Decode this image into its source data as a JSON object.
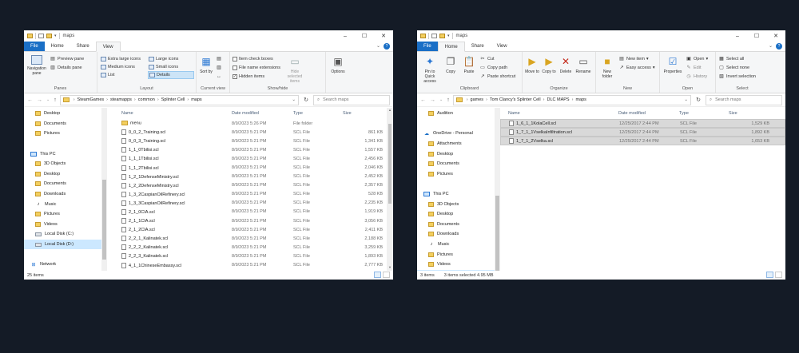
{
  "left": {
    "title": "maps",
    "tabs": [
      "File",
      "Home",
      "Share",
      "View"
    ],
    "ribbon": {
      "panes": {
        "name": "Panes",
        "navigation_pane": "Navigation pane",
        "preview_pane": "Preview pane",
        "details_pane": "Details pane"
      },
      "layout": {
        "name": "Layout",
        "items": [
          "Extra large icons",
          "Large icons",
          "Medium icons",
          "Small icons",
          "List",
          "Details"
        ]
      },
      "current_view": {
        "name": "Current view",
        "sort_by": "Sort by"
      },
      "show_hide": {
        "name": "Show/hide",
        "item_check_boxes": "Item check boxes",
        "file_name_extensions": "File name extensions",
        "hidden_items": "Hidden items",
        "hide_selected": "Hide selected items"
      },
      "options": "Options"
    },
    "path": [
      "SteamGames",
      "steamapps",
      "common",
      "Splinter Cell",
      "maps"
    ],
    "search_placeholder": "Search maps",
    "nav": [
      {
        "label": "Desktop",
        "icon": "folder-icon"
      },
      {
        "label": "Documents",
        "icon": "folder-icon"
      },
      {
        "label": "Pictures",
        "icon": "folder-icon"
      },
      {
        "label": "",
        "icon": ""
      },
      {
        "label": "This PC",
        "icon": "pc-icon"
      },
      {
        "label": "3D Objects",
        "icon": "folder-icon"
      },
      {
        "label": "Desktop",
        "icon": "folder-icon"
      },
      {
        "label": "Documents",
        "icon": "folder-icon"
      },
      {
        "label": "Downloads",
        "icon": "folder-icon"
      },
      {
        "label": "Music",
        "icon": "music-icon"
      },
      {
        "label": "Pictures",
        "icon": "folder-icon"
      },
      {
        "label": "Videos",
        "icon": "folder-icon"
      },
      {
        "label": "Local Disk (C:)",
        "icon": "drive-icon"
      },
      {
        "label": "Local Disk (D:)",
        "icon": "drive-icon"
      },
      {
        "label": "",
        "icon": ""
      },
      {
        "label": "Network",
        "icon": "network-icon"
      }
    ],
    "columns": [
      "Name",
      "Date modified",
      "Type",
      "Size"
    ],
    "files": [
      {
        "name": "menu",
        "date": "8/9/2023 5:26 PM",
        "type": "File folder",
        "size": "",
        "folder": true
      },
      {
        "name": "0_0_2_Training.scl",
        "date": "8/9/2023 5:21 PM",
        "type": "SCL File",
        "size": "861 KB"
      },
      {
        "name": "0_0_3_Training.scl",
        "date": "8/9/2023 5:21 PM",
        "type": "SCL File",
        "size": "1,341 KB"
      },
      {
        "name": "1_1_0Tbilisi.scl",
        "date": "8/9/2023 5:21 PM",
        "type": "SCL File",
        "size": "1,557 KB"
      },
      {
        "name": "1_1_1Tbilisi.scl",
        "date": "8/9/2023 5:21 PM",
        "type": "SCL File",
        "size": "2,456 KB"
      },
      {
        "name": "1_1_2Tbilisi.scl",
        "date": "8/9/2023 5:21 PM",
        "type": "SCL File",
        "size": "2,046 KB"
      },
      {
        "name": "1_2_1DefenseMinistry.scl",
        "date": "8/9/2023 5:21 PM",
        "type": "SCL File",
        "size": "2,452 KB"
      },
      {
        "name": "1_2_2DefenseMinistry.scl",
        "date": "8/9/2023 5:21 PM",
        "type": "SCL File",
        "size": "2,357 KB"
      },
      {
        "name": "1_3_2CaspianOilRefinery.scl",
        "date": "8/9/2023 5:21 PM",
        "type": "SCL File",
        "size": "528 KB"
      },
      {
        "name": "1_3_3CaspianOilRefinery.scl",
        "date": "8/9/2023 5:21 PM",
        "type": "SCL File",
        "size": "2,235 KB"
      },
      {
        "name": "2_1_0CIA.scl",
        "date": "8/9/2023 5:21 PM",
        "type": "SCL File",
        "size": "1,919 KB"
      },
      {
        "name": "2_1_1CIA.scl",
        "date": "8/9/2023 5:21 PM",
        "type": "SCL File",
        "size": "3,056 KB"
      },
      {
        "name": "2_1_2CIA.scl",
        "date": "8/9/2023 5:21 PM",
        "type": "SCL File",
        "size": "2,411 KB"
      },
      {
        "name": "2_2_1_Kalinatek.scl",
        "date": "8/9/2023 5:21 PM",
        "type": "SCL File",
        "size": "2,188 KB"
      },
      {
        "name": "2_2_2_Kalinatek.scl",
        "date": "8/9/2023 5:21 PM",
        "type": "SCL File",
        "size": "3,259 KB"
      },
      {
        "name": "2_2_3_Kalinatek.scl",
        "date": "8/9/2023 5:21 PM",
        "type": "SCL File",
        "size": "1,893 KB"
      },
      {
        "name": "4_1_1ChineseEmbassy.scl",
        "date": "8/9/2023 5:21 PM",
        "type": "SCL File",
        "size": "2,777 KB"
      }
    ],
    "status": "25 items"
  },
  "right": {
    "title": "maps",
    "tabs": [
      "File",
      "Home",
      "Share",
      "View"
    ],
    "ribbon": {
      "clipboard": {
        "name": "Clipboard",
        "pin": "Pin to Quick access",
        "copy": "Copy",
        "paste": "Paste",
        "cut": "Cut",
        "copy_path": "Copy path",
        "paste_shortcut": "Paste shortcut"
      },
      "organize": {
        "name": "Organize",
        "move_to": "Move to",
        "copy_to": "Copy to",
        "delete": "Delete",
        "rename": "Rename"
      },
      "new": {
        "name": "New",
        "new_folder": "New folder",
        "new_item": "New item",
        "easy_access": "Easy access"
      },
      "open": {
        "name": "Open",
        "properties": "Properties",
        "open": "Open",
        "edit": "Edit",
        "history": "History"
      },
      "select": {
        "name": "Select",
        "select_all": "Select all",
        "select_none": "Select none",
        "invert": "Invert selection"
      }
    },
    "path": [
      "games",
      "Tom Clancy's Splinter Cell",
      "DLC MAPS",
      "maps"
    ],
    "search_placeholder": "Search maps",
    "nav": [
      {
        "label": "Audition",
        "icon": "folder-icon"
      },
      {
        "label": "",
        "icon": ""
      },
      {
        "label": "OneDrive - Personal",
        "icon": "cloud-icon"
      },
      {
        "label": "Attachments",
        "icon": "folder-icon"
      },
      {
        "label": "Desktop",
        "icon": "folder-icon"
      },
      {
        "label": "Documents",
        "icon": "folder-icon"
      },
      {
        "label": "Pictures",
        "icon": "folder-icon"
      },
      {
        "label": "",
        "icon": ""
      },
      {
        "label": "This PC",
        "icon": "pc-icon"
      },
      {
        "label": "3D Objects",
        "icon": "folder-icon"
      },
      {
        "label": "Desktop",
        "icon": "folder-icon"
      },
      {
        "label": "Documents",
        "icon": "folder-icon"
      },
      {
        "label": "Downloads",
        "icon": "folder-icon"
      },
      {
        "label": "Music",
        "icon": "music-icon"
      },
      {
        "label": "Pictures",
        "icon": "folder-icon"
      },
      {
        "label": "Videos",
        "icon": "folder-icon"
      },
      {
        "label": "Local Disk (C:)",
        "icon": "drive-icon"
      }
    ],
    "columns": [
      "Name",
      "Date modified",
      "Type",
      "Size"
    ],
    "files": [
      {
        "name": "1_6_1_1KolaCell.scl",
        "date": "12/25/2017 2:44 PM",
        "type": "SCL File",
        "size": "1,529 KB"
      },
      {
        "name": "1_7_1_1VselkaInfiltration.scl",
        "date": "12/25/2017 2:44 PM",
        "type": "SCL File",
        "size": "1,892 KB"
      },
      {
        "name": "1_7_1_2Vselka.scl",
        "date": "12/25/2017 2:44 PM",
        "type": "SCL File",
        "size": "1,653 KB"
      }
    ],
    "status_count": "3 items",
    "status_selected": "3 items selected  4.95 MB"
  }
}
